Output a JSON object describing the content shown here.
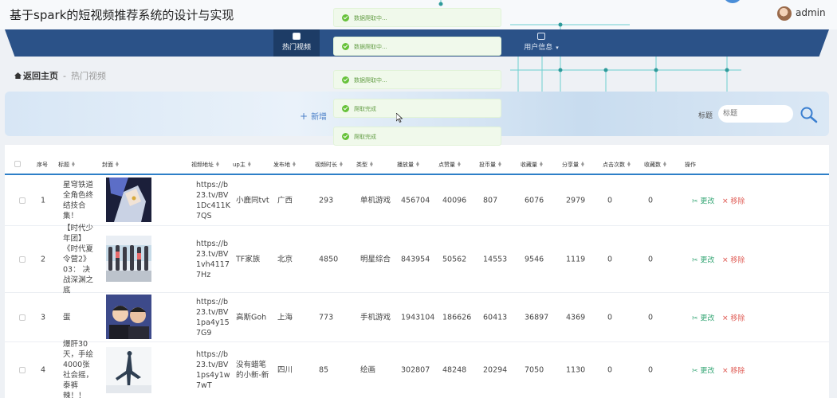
{
  "app": {
    "title": "基于spark的短视频推荐系统的设计与实现"
  },
  "user": {
    "name": "admin",
    "avatar_icon": "user-avatar"
  },
  "nav": {
    "items": [
      {
        "label": "热门视频",
        "icon": "video-icon",
        "active": true
      },
      {
        "label": "用户信息",
        "icon": "id-card-icon",
        "has_dropdown": true
      }
    ]
  },
  "breadcrumb": {
    "home": "返回主页",
    "separator": "-",
    "current": "热门视频"
  },
  "search": {
    "add_label": "新增",
    "title_label": "标题",
    "title_placeholder": "标题"
  },
  "table": {
    "columns": [
      "序号",
      "标题",
      "封面",
      "视频地址",
      "up主",
      "发布地",
      "视频时长",
      "类型",
      "播放量",
      "点赞量",
      "投币量",
      "收藏量",
      "分享量",
      "点击次数",
      "收藏数",
      "操作"
    ],
    "edit_label": "更改",
    "delete_label": "移除",
    "rows": [
      {
        "index": "1",
        "title": "星穹铁道全角色终结技合集！",
        "url": "https://b23.tv/BV1Dc411K7QS",
        "uploader": "小鹿同tvt",
        "location": "广西",
        "duration": "293",
        "category": "单机游戏",
        "plays": "456704",
        "likes": "40096",
        "coins": "807",
        "favorites": "6076",
        "shares": "2979",
        "clicks": "0",
        "collects": "0"
      },
      {
        "index": "2",
        "title": "【时代少年团】《时代夏令营2》03： 决战深渊之底",
        "url": "https://b23.tv/BV1vh41177Hz",
        "uploader": "TF家族",
        "location": "北京",
        "duration": "4850",
        "category": "明星综合",
        "plays": "843954",
        "likes": "50562",
        "coins": "14553",
        "favorites": "9546",
        "shares": "1119",
        "clicks": "0",
        "collects": "0"
      },
      {
        "index": "3",
        "title": "蛋",
        "url": "https://b23.tv/BV1pa4y157G9",
        "uploader": "高斯Goh",
        "location": "上海",
        "duration": "773",
        "category": "手机游戏",
        "plays": "1943104",
        "likes": "186626",
        "coins": "60413",
        "favorites": "36897",
        "shares": "4369",
        "clicks": "0",
        "collects": "0"
      },
      {
        "index": "4",
        "title": "爆肝30天，手绘4000张社会摇，泰裤辣！！",
        "url": "https://b23.tv/BV1ps4y1w7wT",
        "uploader": "没有蜡笔的小新-新",
        "location": "四川",
        "duration": "85",
        "category": "绘画",
        "plays": "302807",
        "likes": "48248",
        "coins": "20294",
        "favorites": "7050",
        "shares": "1130",
        "clicks": "0",
        "collects": "0"
      }
    ]
  },
  "toasts": [
    "数据爬取中...",
    "数据爬取中...",
    "数据爬取中...",
    "爬取完成",
    "爬取完成"
  ],
  "colors": {
    "nav_bg": "#2b5288",
    "nav_active": "#1d3c66",
    "accent": "#2e7fc8",
    "success": "#67c23a",
    "danger": "#e0605a",
    "edit": "#3aa878"
  }
}
